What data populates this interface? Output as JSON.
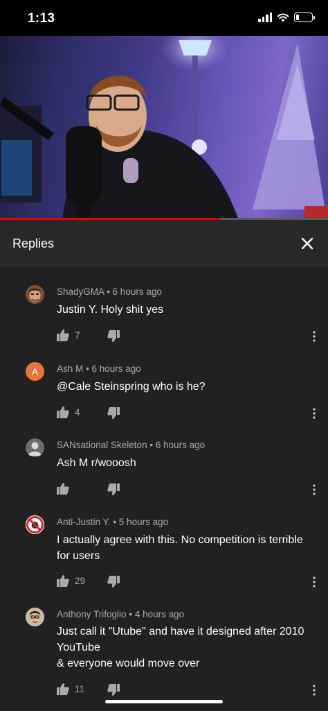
{
  "status_bar": {
    "time": "1:13"
  },
  "video": {
    "progress_fraction": 0.67
  },
  "header": {
    "title": "Replies"
  },
  "comments": [
    {
      "author": "ShadyGMA",
      "age": "6 hours ago",
      "lines": [
        "Justin Y. Holy shit yes"
      ],
      "likes": "7",
      "avatar_letter": ""
    },
    {
      "author": "Ash M",
      "age": "6 hours ago",
      "lines": [
        "@Cale Steinspring who is he?"
      ],
      "likes": "4",
      "avatar_letter": "A"
    },
    {
      "author": "SANsational Skeleton",
      "age": "6 hours ago",
      "lines": [
        "Ash M r/wooosh"
      ],
      "likes": "",
      "avatar_letter": ""
    },
    {
      "author": "Anti-Justin Y.",
      "age": "5 hours ago",
      "lines": [
        "I actually agree with this. No competition is terrible",
        "for users"
      ],
      "likes": "29",
      "avatar_letter": ""
    },
    {
      "author": "Anthony Trifoglio",
      "age": "4 hours ago",
      "lines": [
        "Just call it \"Utube\" and have it designed after 2010",
        "YouTube",
        "& everyone would move over"
      ],
      "likes": "11",
      "avatar_letter": ""
    }
  ],
  "colors": {
    "background": "#212121",
    "header": "#282828",
    "progress": "#ee0000",
    "avatar_ash": "#e8743b",
    "meta": "#aaaaaa"
  },
  "icons": {
    "like": "thumbs-up-icon",
    "dislike": "thumbs-down-icon",
    "more": "more-vertical-icon",
    "close": "close-icon"
  }
}
